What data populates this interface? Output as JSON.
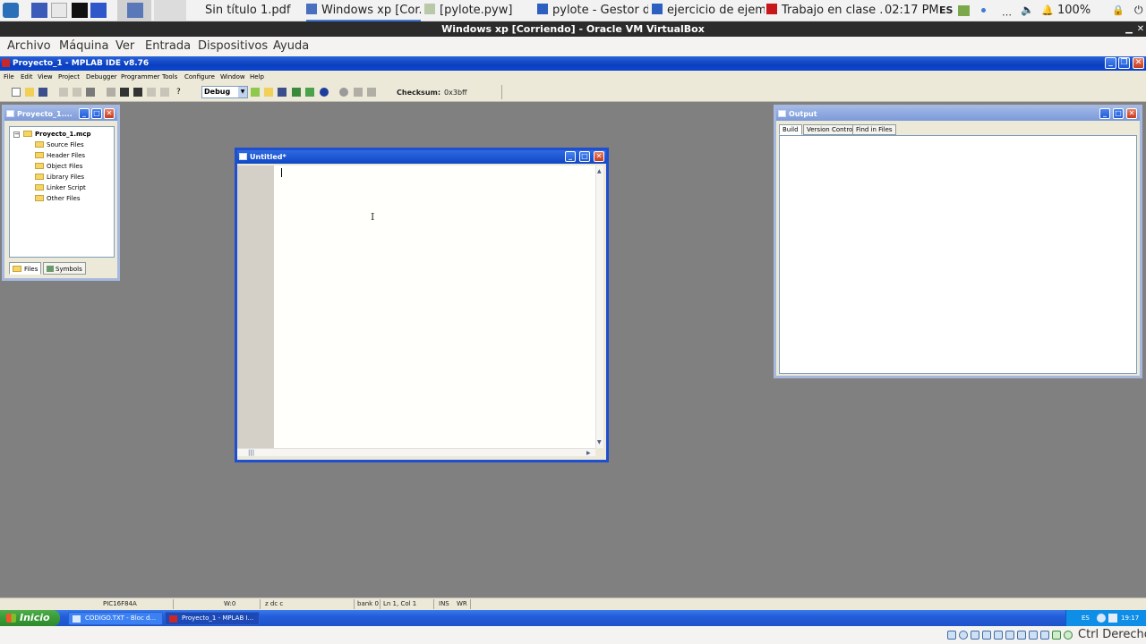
{
  "host_taskbar": {
    "tabs": [
      {
        "label": "Sin título 1.pdf"
      },
      {
        "label": "Windows xp [Cor..."
      },
      {
        "label": "[pylote.pyw]"
      },
      {
        "label": "pylote - Gestor d..."
      },
      {
        "label": "ejercicio de ejem..."
      },
      {
        "label": "Trabajo en clase ..."
      }
    ],
    "clock": "02:17 PM",
    "lang": "ES",
    "battery": "100%"
  },
  "vbox": {
    "title": "Windows xp [Corriendo] - Oracle VM VirtualBox",
    "menu": [
      "Archivo",
      "Máquina",
      "Ver",
      "Entrada",
      "Dispositivos",
      "Ayuda"
    ],
    "host_key": "Ctrl Derecho"
  },
  "mplab": {
    "title": "Proyecto_1 - MPLAB IDE v8.76",
    "menu": [
      "File",
      "Edit",
      "View",
      "Project",
      "Debugger",
      "Programmer",
      "Tools",
      "Configure",
      "Window",
      "Help"
    ],
    "config_select": "Debug",
    "checksum_label": "Checksum:",
    "checksum_value": "0x3bff"
  },
  "project_window": {
    "title": "Proyecto_1....",
    "root": "Proyecto_1.mcp",
    "folders": [
      "Source Files",
      "Header Files",
      "Object Files",
      "Library Files",
      "Linker Script",
      "Other Files"
    ],
    "tabs": [
      "Files",
      "Symbols"
    ]
  },
  "editor_window": {
    "title": "Untitled*"
  },
  "output_window": {
    "title": "Output",
    "tabs": [
      "Build",
      "Version Control",
      "Find in Files"
    ]
  },
  "statusbar": {
    "device": "PIC16F84A",
    "w_reg": "W:0",
    "flags": "z dc c",
    "bank": "bank 0",
    "position": "Ln 1, Col 1",
    "ins": "INS",
    "wr": "WR"
  },
  "xp_taskbar": {
    "start": "Inicio",
    "tasks": [
      "CODIGO.TXT - Bloc d...",
      "Proyecto_1 - MPLAB I..."
    ],
    "tray_lang": "ES",
    "tray_time": "19:17"
  }
}
